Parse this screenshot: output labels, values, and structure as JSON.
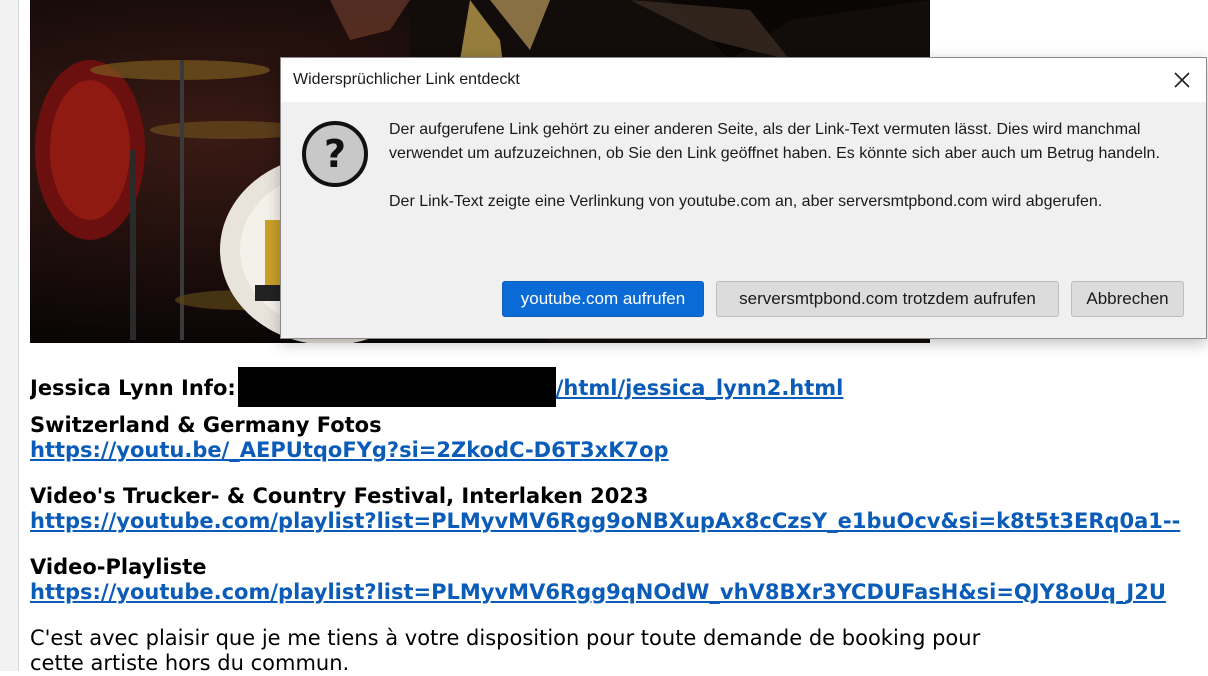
{
  "dialog": {
    "title": "Widersprüchlicher Link entdeckt",
    "message_1": "Der aufgerufene Link gehört zu einer anderen Seite, als der Link-Text vermuten lässt. Dies wird manchmal verwendet um aufzuzeichnen, ob Sie den Link geöffnet haben. Es könnte sich aber auch um Betrug handeln.",
    "message_2": "Der Link-Text zeigte eine Verlinkung von youtube.com an, aber serversmtpbond.com wird abgerufen.",
    "btn_primary": "youtube.com aufrufen",
    "btn_secondary": "serversmtpbond.com trotzdem aufrufen",
    "btn_cancel": "Abbrechen",
    "icons": {
      "close": "close-icon",
      "question": "question-icon"
    }
  },
  "email": {
    "info_label": "Jessica Lynn Info:",
    "info_link": "/html/jessica_lynn2.html",
    "fotos_heading": "Switzerland & Germany Fotos",
    "fotos_link": "https://youtu.be/_AEPUtqoFYg?si=2ZkodC-D6T3xK7op",
    "festival_heading": "Video's Trucker- & Country Festival, Interlaken 2023",
    "festival_link": "https://youtube.com/playlist?list=PLMyvMV6Rgg9oNBXupAx8cCzsY_e1buOcv&si=k8t5t3ERq0a1--",
    "playlist_heading": "Video-Playliste",
    "playlist_link": "https://youtube.com/playlist?list=PLMyvMV6Rgg9qNOdW_vhV8BXr3YCDUFasH&si=QJY8oUq_J2U",
    "closing_line_1": "C'est avec plaisir que je me tiens à votre disposition pour toute demande de booking pour",
    "closing_line_2": "cette artiste hors du commun."
  },
  "colors": {
    "link": "#0a5cb8",
    "primary_button": "#0a6bd6",
    "dialog_bg": "#f0f0f0"
  }
}
